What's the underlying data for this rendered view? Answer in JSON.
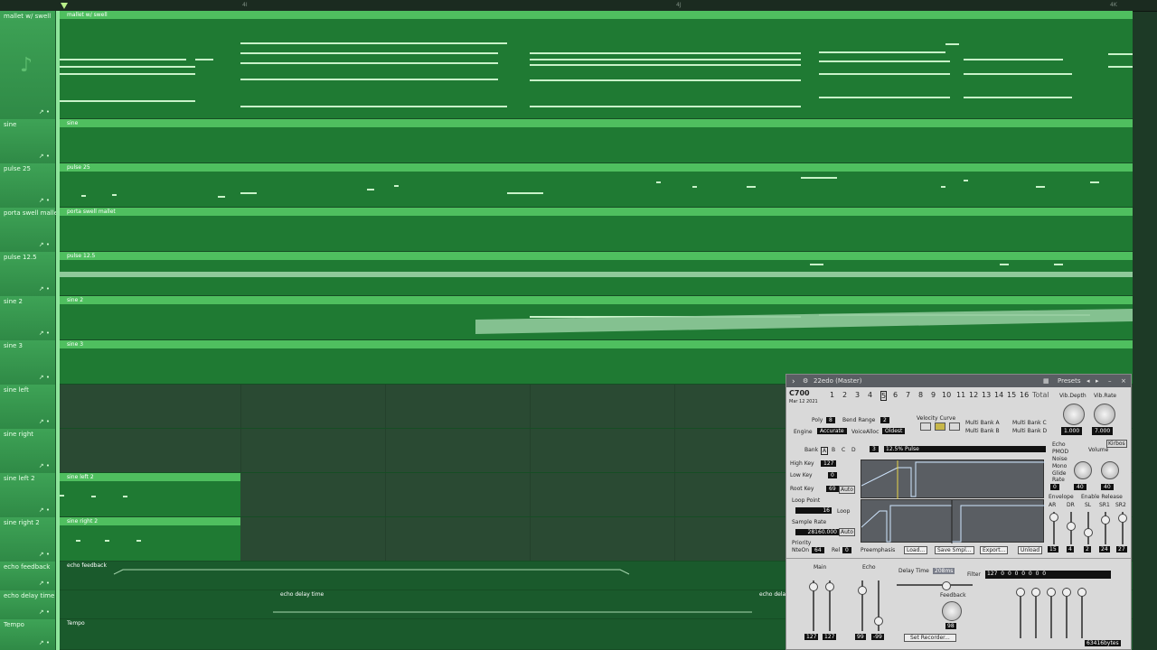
{
  "ruler": {
    "labels": [
      "",
      "",
      "",
      "4I",
      "",
      "",
      "",
      "4J",
      "",
      "",
      "",
      "4K"
    ]
  },
  "tracks": [
    {
      "name": "mallet w/ swell",
      "clip": "mallet w/ swell"
    },
    {
      "name": "sine",
      "clip": "sine"
    },
    {
      "name": "pulse 25",
      "clip": "pulse 25"
    },
    {
      "name": "porta swell mallet",
      "clip": "porta swell mallet"
    },
    {
      "name": "pulse 12.5",
      "clip": "pulse 12.5"
    },
    {
      "name": "sine 2",
      "clip": "sine 2"
    },
    {
      "name": "sine 3",
      "clip": "sine 3"
    },
    {
      "name": "sine left",
      "clip": ""
    },
    {
      "name": "sine right",
      "clip": ""
    },
    {
      "name": "sine left 2",
      "clip": "sine left 2"
    },
    {
      "name": "sine right 2",
      "clip": "sine right 2"
    },
    {
      "name": "echo feedback",
      "clip": "echo feedback"
    },
    {
      "name": "echo delay time",
      "clip": "echo delay time",
      "clip2": "echo delay time",
      "clip3": "echo dela"
    },
    {
      "name": "Tempo",
      "clip": "Tempo"
    }
  ],
  "plugin": {
    "title": "22edo (Master)",
    "presets": "Presets",
    "chip": "C700",
    "date": "Mar 12 2021",
    "channels": [
      "1",
      "2",
      "3",
      "4",
      "5",
      "6",
      "7",
      "8",
      "9",
      "10",
      "11",
      "12",
      "13",
      "14",
      "15",
      "16"
    ],
    "total": "Total",
    "vib_depth": "Vib.Depth",
    "vib_rate": "Vib.Rate",
    "vib_depth_val": "1.000",
    "vib_rate_val": "7.000",
    "poly": "Poly",
    "poly_val": "8",
    "bend_range": "Bend Range",
    "bend_val": "2",
    "engine": "Engine",
    "engine_val": "Accurate",
    "voice_alloc": "VoiceAlloc",
    "voice_val": "Oldest",
    "velocity_curve": "Velocity Curve",
    "multi_bank": [
      "Multi Bank A",
      "Multi Bank C",
      "Multi Bank B",
      "Multi Bank D"
    ],
    "bank": "Bank",
    "bank_letters": [
      "A",
      "B",
      "C",
      "D"
    ],
    "program_num": "3",
    "program_name": "12.5% Pulse",
    "options": [
      "Echo",
      "PMOD",
      "Noise",
      "Mono",
      "Glide"
    ],
    "rate": "Rate",
    "rate_val": "0",
    "volume": "Volume",
    "vol_l": "40",
    "vol_r": "40",
    "high_key": "High Key",
    "high_key_val": "127",
    "low_key": "Low Key",
    "low_key_val": "0",
    "root_key": "Root Key",
    "root_key_val": "69",
    "auto": "Auto",
    "loop_point": "Loop Point",
    "loop_point_val": "16",
    "loop": "Loop",
    "sample_rate": "Sample Rate",
    "sample_rate_val": "28160.000",
    "priority": "Priority",
    "nte_on": "NteOn",
    "nte_on_val": "64",
    "rel": "Rel",
    "rel_val": "0",
    "preemphasis": "Preemphasis",
    "load": "Load...",
    "save_smpl": "Save Smpl...",
    "export": "Export...",
    "unload": "Unload",
    "envelope": "Envelope",
    "enable_release": "Enable Release",
    "env_labels": [
      "AR",
      "DR",
      "SL",
      "SR1",
      "SR2"
    ],
    "env_vals": [
      "15",
      "4",
      "2",
      "24",
      "27"
    ],
    "main": "Main",
    "echo": "Echo",
    "main_vals": [
      "127",
      "127"
    ],
    "echo_vals": [
      "99",
      "-99"
    ],
    "delay_time": "Delay Time",
    "delay_val": "208ms",
    "feedback": "Feedback",
    "feedback_val": "98",
    "filter": "Filter",
    "filter_vals": [
      "127",
      "0",
      "0",
      "0",
      "0",
      "0",
      "0",
      "0"
    ],
    "set_recorder": "Set Recorder...",
    "bytes": "63416bytes",
    "kirbos": "Kirbos"
  }
}
